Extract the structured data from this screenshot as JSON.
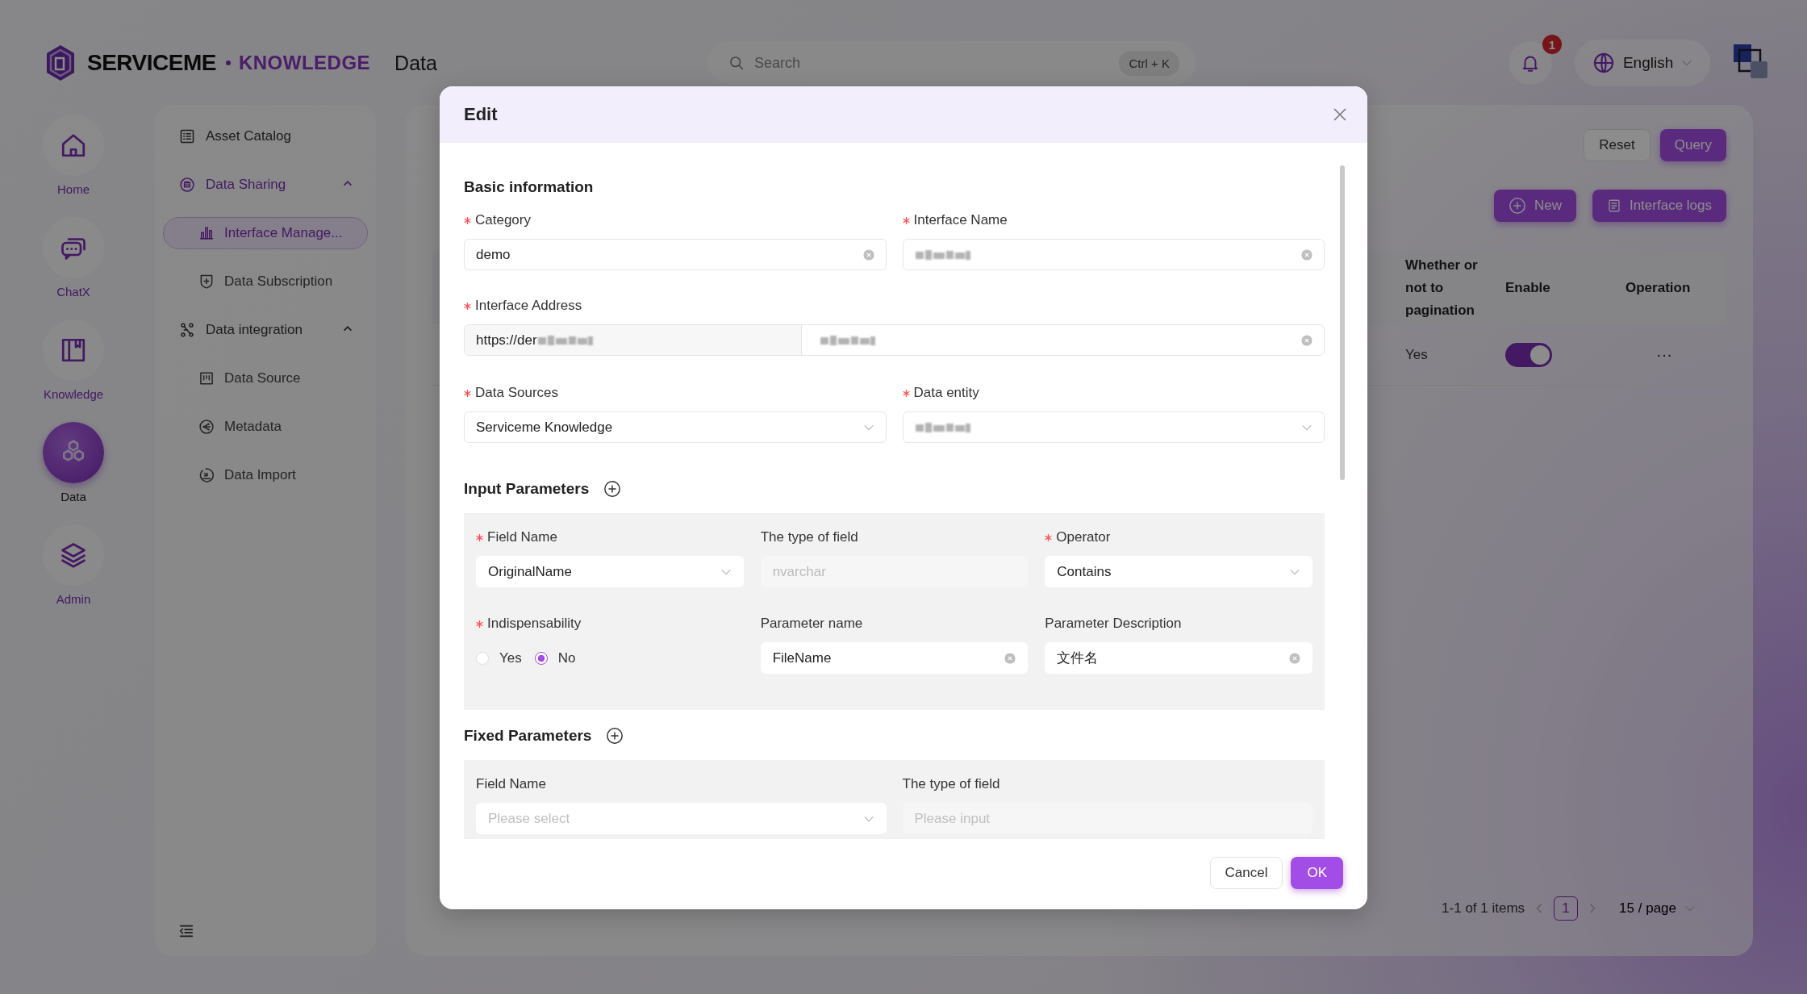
{
  "header": {
    "brand_name": "SERVICEME",
    "brand_product": "KNOWLEDGE",
    "section": "Data",
    "search": {
      "placeholder": "Search",
      "shortcut": "Ctrl + K"
    },
    "notifications": {
      "count": "1"
    },
    "language": "English"
  },
  "rail": [
    {
      "label": "Home",
      "selected": false
    },
    {
      "label": "ChatX",
      "selected": false
    },
    {
      "label": "Knowledge",
      "selected": false
    },
    {
      "label": "Data",
      "selected": true
    },
    {
      "label": "Admin",
      "selected": false
    }
  ],
  "menu": [
    {
      "label": "Asset Catalog",
      "kind": "item",
      "selected": false
    },
    {
      "label": "Data Sharing",
      "kind": "group",
      "selected": true,
      "expanded": true,
      "children": [
        {
          "label": "Interface Manage...",
          "selected": true
        },
        {
          "label": "Data Subscription",
          "selected": false
        }
      ]
    },
    {
      "label": "Data integration",
      "kind": "group",
      "selected": false,
      "expanded": true,
      "children": [
        {
          "label": "Data Source",
          "selected": false
        },
        {
          "label": "Metadata",
          "selected": false
        },
        {
          "label": "Data Import",
          "selected": false
        }
      ]
    }
  ],
  "toolbar": {
    "reset": "Reset",
    "query": "Query",
    "new": "New",
    "logs": "Interface logs"
  },
  "table": {
    "columns": [
      "Whether or not to pagination",
      "Enable",
      "Operation"
    ],
    "rows": [
      {
        "pagination": "Yes",
        "enabled": true,
        "operation": "···"
      }
    ]
  },
  "pagination": {
    "summary": "1-1 of 1 items",
    "pages": [
      {
        "label": "1",
        "selected": true
      }
    ],
    "page_size": "15 / page"
  },
  "modal": {
    "title": "Edit",
    "basic_information": {
      "title": "Basic information",
      "category": {
        "label": "Category",
        "required": true,
        "kind": "input",
        "value": "demo",
        "clearable": true
      },
      "interface_name": {
        "label": "Interface Name",
        "required": true,
        "kind": "input",
        "redacted": true,
        "clearable": true
      },
      "interface_address": {
        "label": "Interface Address",
        "required": true,
        "kind": "address",
        "prefix": "https://der",
        "redacted": true,
        "clearable": true
      },
      "data_sources": {
        "label": "Data Sources",
        "required": true,
        "kind": "select",
        "value": "Serviceme Knowledge"
      },
      "data_entity": {
        "label": "Data entity",
        "required": true,
        "kind": "select",
        "redacted": true
      }
    },
    "input_parameters": {
      "title": "Input Parameters",
      "rows": [
        {
          "field_name": {
            "label": "Field Name",
            "required": true,
            "kind": "select",
            "value": "OriginalName"
          },
          "field_type": {
            "label": "The type of field",
            "required": false,
            "kind": "input",
            "value": "nvarchar",
            "disabled": true
          },
          "operator": {
            "label": "Operator",
            "required": true,
            "kind": "select",
            "value": "Contains"
          },
          "indispensability": {
            "label": "Indispensability",
            "required": true,
            "kind": "radio",
            "options": [
              {
                "label": "Yes",
                "selected": false
              },
              {
                "label": "No",
                "selected": true
              }
            ]
          },
          "parameter_name": {
            "label": "Parameter name",
            "required": false,
            "kind": "input",
            "value": "FileName",
            "clearable": true
          },
          "parameter_description": {
            "label": "Parameter Description",
            "required": false,
            "kind": "input",
            "value": "文件名",
            "clearable": true
          }
        }
      ]
    },
    "fixed_parameters": {
      "title": "Fixed Parameters",
      "rows": [
        {
          "field_name": {
            "label": "Field Name",
            "required": false,
            "kind": "select",
            "placeholder": "Please select"
          },
          "field_type": {
            "label": "The type of field",
            "required": false,
            "kind": "input",
            "placeholder": "Please input",
            "disabled": true
          }
        }
      ]
    },
    "buttons": {
      "cancel": "Cancel",
      "ok": "OK"
    }
  }
}
